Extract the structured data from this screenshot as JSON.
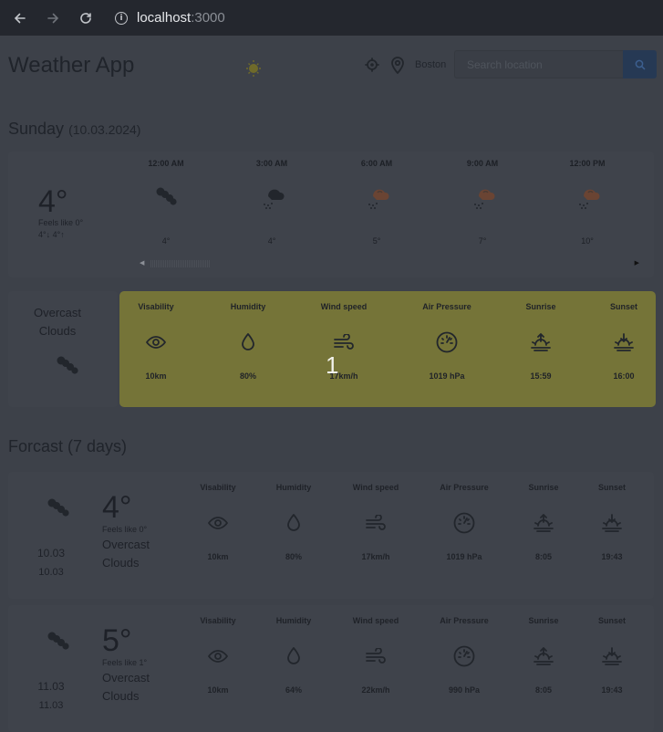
{
  "browser": {
    "url_host": "localhost",
    "url_port": ":3000"
  },
  "header": {
    "title": "Weather App",
    "city": "Boston",
    "search_placeholder": "Search location"
  },
  "today": {
    "day": "Sunday",
    "date": "(10.03.2024)",
    "temp": "4°",
    "feels_like": "Feels like 0°",
    "min_max": "4°↓   4°↑",
    "description": [
      "Overcast",
      "Clouds"
    ],
    "hourly": [
      {
        "time": "12:00 AM",
        "temp": "4°",
        "icon": "cloud-icon"
      },
      {
        "time": "3:00 AM",
        "temp": "4°",
        "icon": "rain-icon"
      },
      {
        "time": "6:00 AM",
        "temp": "5°",
        "icon": "rain-icon"
      },
      {
        "time": "9:00 AM",
        "temp": "7°",
        "icon": "rain-icon"
      },
      {
        "time": "12:00 PM",
        "temp": "10°",
        "icon": "rain-icon"
      }
    ],
    "details": [
      {
        "label": "Visability",
        "value": "10km",
        "icon": "eye-icon"
      },
      {
        "label": "Humidity",
        "value": "80%",
        "icon": "droplet-icon"
      },
      {
        "label": "Wind speed",
        "value": "17km/h",
        "icon": "wind-icon"
      },
      {
        "label": "Air Pressure",
        "value": "1019 hPa",
        "icon": "gauge-icon"
      },
      {
        "label": "Sunrise",
        "value": "15:59",
        "icon": "sunrise-icon"
      },
      {
        "label": "Sunset",
        "value": "16:00",
        "icon": "sunset-icon"
      }
    ],
    "highlight_label": "1"
  },
  "forecast": {
    "heading": "Forcast (7 days)",
    "days": [
      {
        "date1": "10.03",
        "date2": "10.03",
        "temp": "4°",
        "feels_like": "Feels like 0°",
        "description": [
          "Overcast",
          "Clouds"
        ],
        "details": [
          {
            "label": "Visability",
            "value": "10km"
          },
          {
            "label": "Humidity",
            "value": "80%"
          },
          {
            "label": "Wind speed",
            "value": "17km/h"
          },
          {
            "label": "Air Pressure",
            "value": "1019 hPa"
          },
          {
            "label": "Sunrise",
            "value": "8:05"
          },
          {
            "label": "Sunset",
            "value": "19:43"
          }
        ]
      },
      {
        "date1": "11.03",
        "date2": "11.03",
        "temp": "5°",
        "feels_like": "Feels like 1°",
        "description": [
          "Overcast",
          "Clouds"
        ],
        "details": [
          {
            "label": "Visability",
            "value": "10km"
          },
          {
            "label": "Humidity",
            "value": "64%"
          },
          {
            "label": "Wind speed",
            "value": "22km/h"
          },
          {
            "label": "Air Pressure",
            "value": "990 hPa"
          },
          {
            "label": "Sunrise",
            "value": "8:05"
          },
          {
            "label": "Sunset",
            "value": "19:43"
          }
        ]
      }
    ]
  },
  "colors": {
    "page_bg": "#3d4149",
    "highlight": "#757438",
    "search_button": "#263954"
  }
}
